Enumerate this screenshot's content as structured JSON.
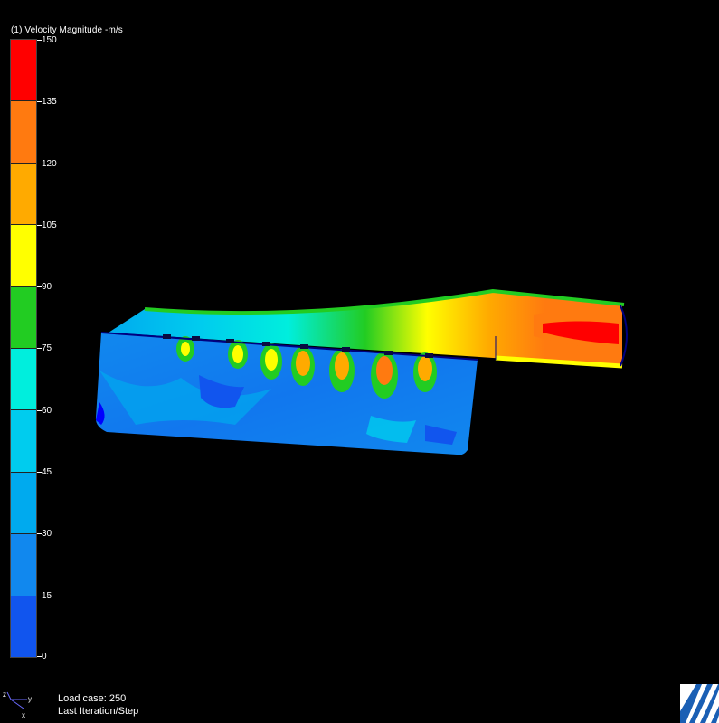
{
  "legend": {
    "title": "(1) Velocity Magnitude -m/s",
    "ticks": [
      "150",
      "135",
      "120",
      "105",
      "90",
      "75",
      "60",
      "45",
      "30",
      "15",
      "0"
    ],
    "colors": [
      "#ff0000",
      "#ff7a10",
      "#ffaa00",
      "#ffff00",
      "#22cc22",
      "#00eedd",
      "#00ccee",
      "#00aaee",
      "#1188ee",
      "#1155ee",
      "#0000ff"
    ]
  },
  "status": {
    "load_case": "Load case: 250",
    "iteration": "Last Iteration/Step"
  },
  "triad": {
    "z": "z",
    "y": "y",
    "x": "x"
  },
  "colors": {
    "background": "#000000",
    "outline": "#000080"
  }
}
